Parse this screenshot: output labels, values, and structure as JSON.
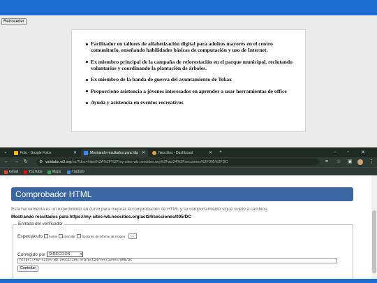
{
  "outer": {
    "back_label": "Retroceder",
    "items": [
      "Facilitador en talleres de alfabetización digital para adultos mayores en el centro comunitario, enseñando habilidades básicas de computación y uso de Internet.",
      "Ex miembro principal de la campaña de reforestación en el parque municipal, reclutando voluntarios y coordinando la plantación de árboles.",
      "Ex miembro de la banda de guerra del ayuntamiento de Tekax",
      "Proporciono asistencia a jóvenes interesados en aprender a usar herramientas de office",
      "Ayuda y asistencia en eventos recreativos"
    ]
  },
  "browser": {
    "tabs": [
      {
        "label": "Foto - Google Fotos",
        "color": "#f4b400"
      },
      {
        "label": "Mostrando resultados para http",
        "color": "#4285f4"
      },
      {
        "label": "Neocities - Dashboard",
        "color": "#e8a23a"
      }
    ],
    "url_host": "validator.w3.org",
    "url_rest": "/nu/?doc=https%3A%2F%2Fmy-sites-wb.neocities.org%2Fact24%2Fsecciones%2F005%2FDC",
    "bookmarks": [
      {
        "label": "Gmail",
        "color": "#ea4335"
      },
      {
        "label": "YouTube",
        "color": "#ff0000"
      },
      {
        "label": "Maps",
        "color": "#34a853"
      },
      {
        "label": "Traducir",
        "color": "#4285f4"
      }
    ]
  },
  "validator": {
    "title": "Comprobador HTML",
    "note": "Esta herramienta es un experimento en curso para mejorar la comprobación de HTML y su comportamiento sigue sujeto a cambios.",
    "results": "Mostrando resultados para https://my-sites-wb.neocities.org/act24/secciones/005/DC",
    "legend": "Entrada del verificador",
    "show_label": "Espectáculo",
    "opt_source": "fuente",
    "opt_outline": "describir",
    "opt_image": "Opciones de informe de imagen",
    "ellipsis": "...",
    "checked_by": "Corregido por",
    "select_value": "DIRECCIÓN",
    "url_value": "https://my-sites-wb.neocities.org/act24/secciones/005/DC",
    "check_button": "Controlar"
  }
}
